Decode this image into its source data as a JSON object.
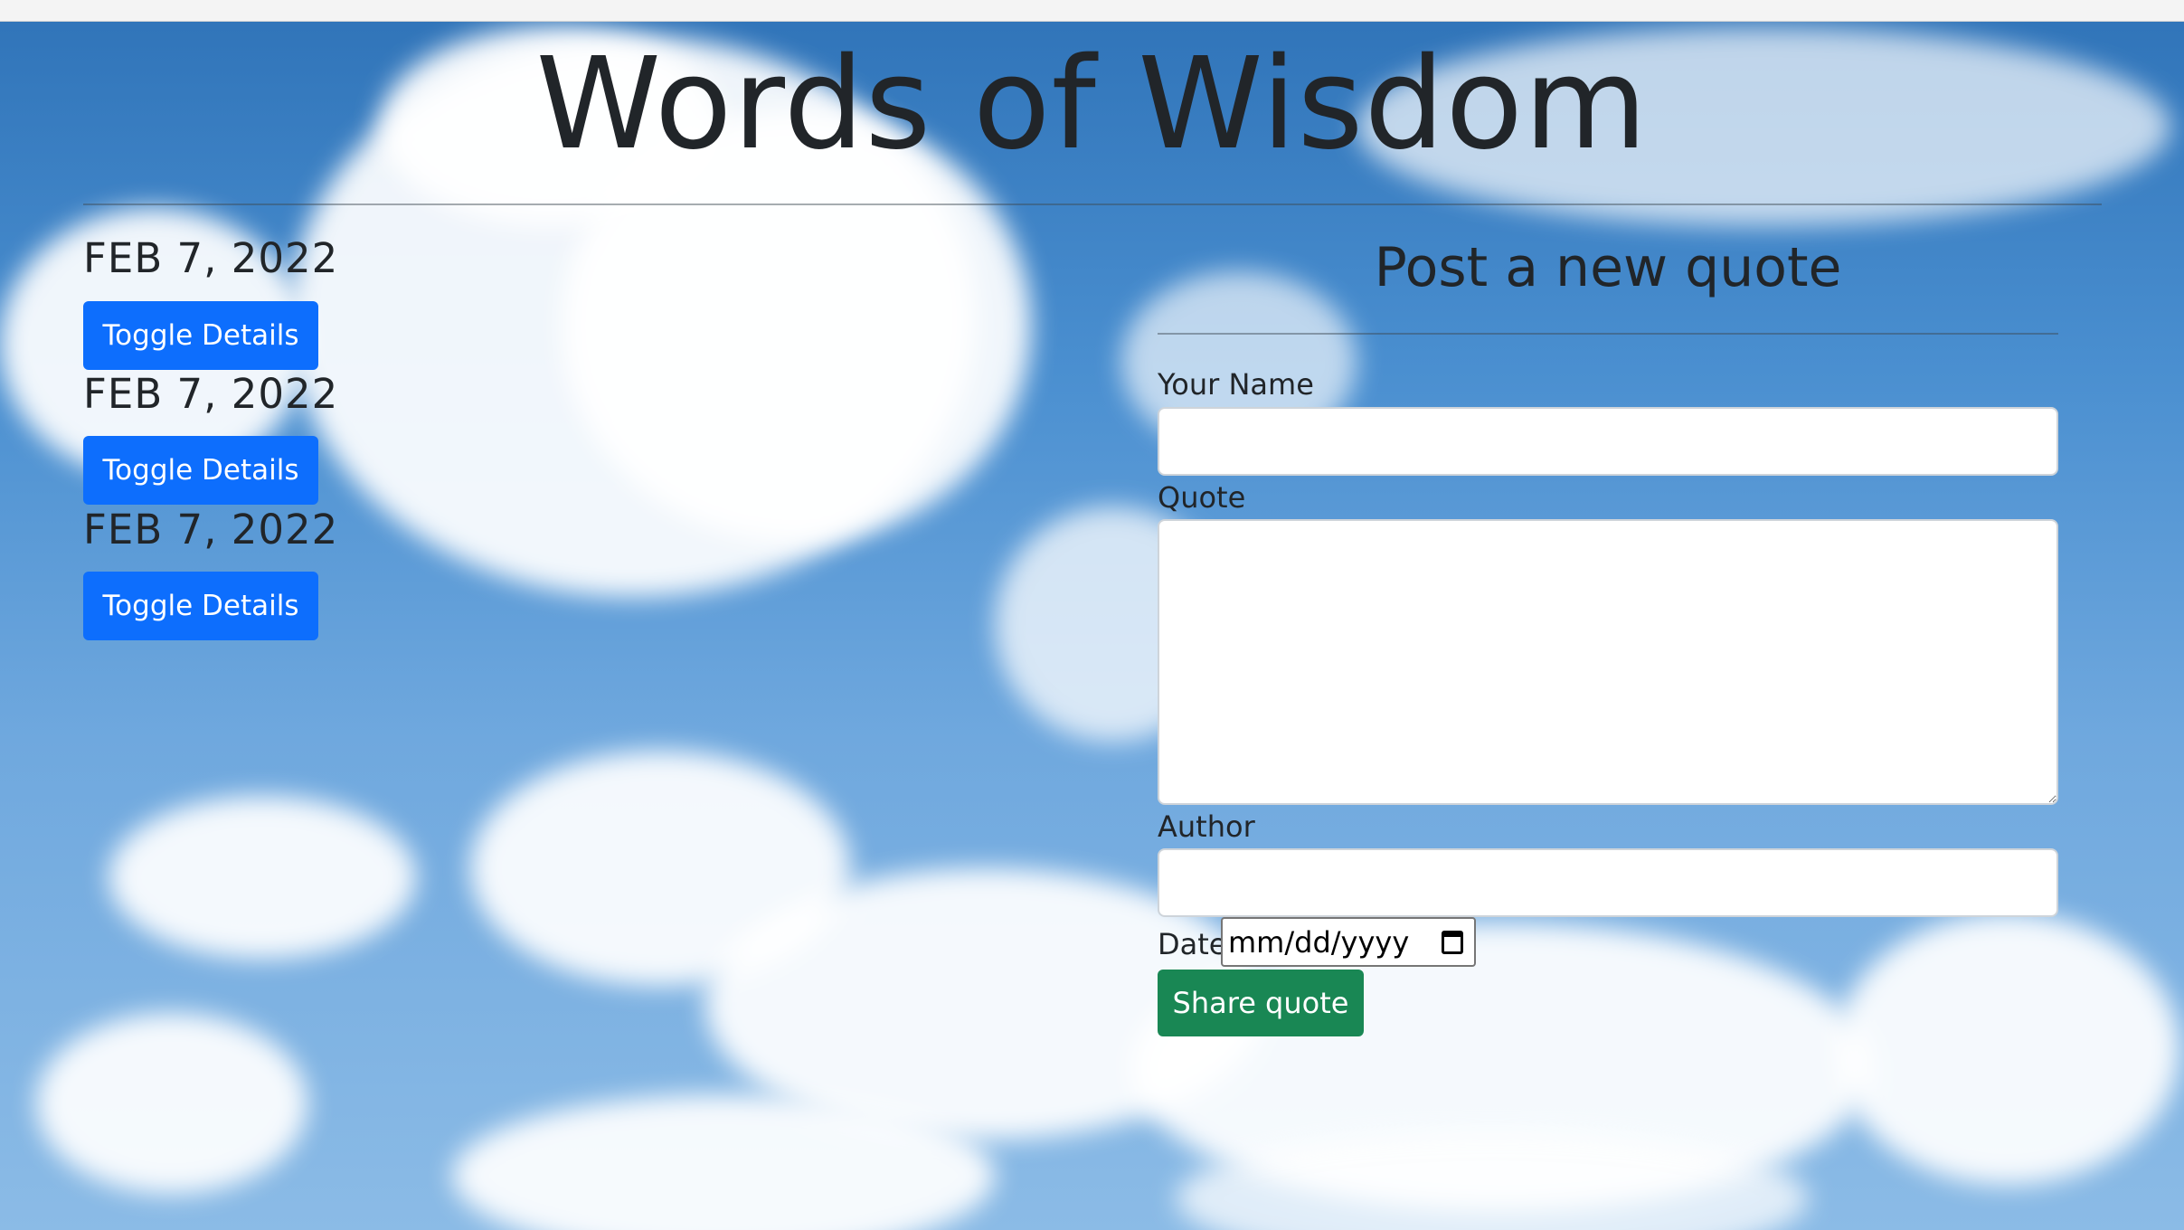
{
  "page": {
    "title": "Words of Wisdom"
  },
  "quotes": [
    {
      "date": "FEB 7, 2022",
      "toggle_label": "Toggle Details"
    },
    {
      "date": "FEB 7, 2022",
      "toggle_label": "Toggle Details"
    },
    {
      "date": "FEB 7, 2022",
      "toggle_label": "Toggle Details"
    }
  ],
  "form": {
    "heading": "Post a new quote",
    "name_label": "Your Name",
    "name_value": "",
    "quote_label": "Quote",
    "quote_value": "",
    "author_label": "Author",
    "author_value": "",
    "date_label": "Date",
    "date_placeholder": "mm/dd/yyyy",
    "submit_label": "Share quote"
  },
  "colors": {
    "primary_button": "#0d6efd",
    "success_button": "#198754",
    "text": "#212529",
    "background": "sky-with-clouds"
  },
  "icons": {
    "date_picker": "calendar-icon"
  }
}
